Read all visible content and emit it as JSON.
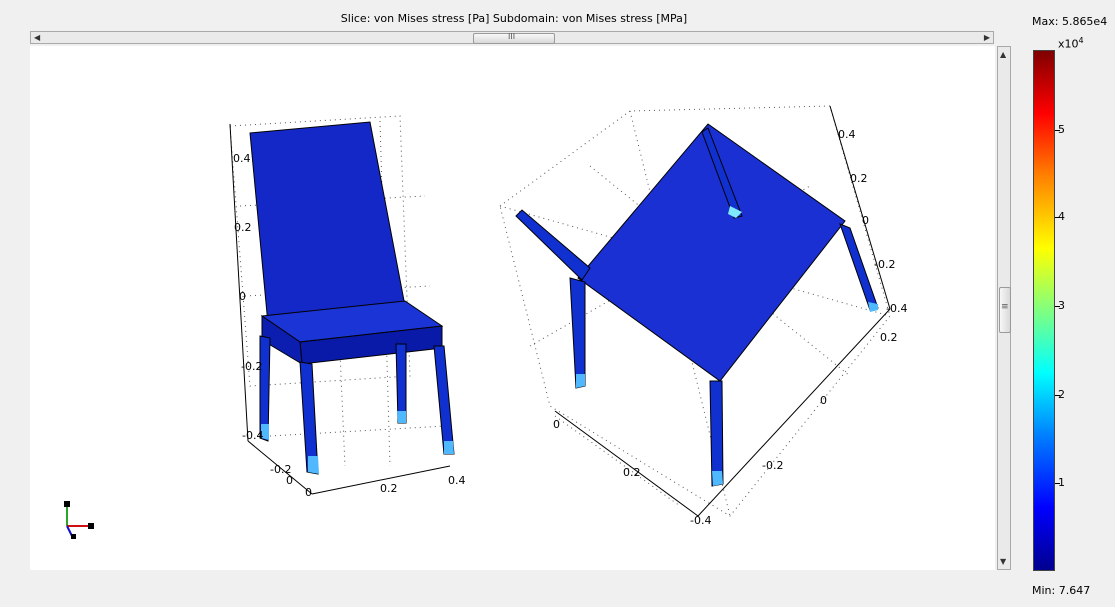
{
  "title": "Slice: von Mises stress [Pa]   Subdomain: von Mises stress [MPa]",
  "hscroll_thumb_grip": "III",
  "vscroll_thumb_grip": "≡",
  "colorbar": {
    "max_label": "Max: 5.865e4",
    "min_label": "Min: 7.647",
    "exponent_base": "x10",
    "exponent_power": "4",
    "ticks": [
      "5",
      "4",
      "3",
      "2",
      "1"
    ],
    "colormap": "jet"
  },
  "left_view": {
    "z_ticks": [
      "0.4",
      "0.2",
      "0",
      "-0.2",
      "-0.4"
    ],
    "y_ticks": [
      "-0.2",
      "0"
    ],
    "x_ticks": [
      "0",
      "0.2",
      "0.4"
    ]
  },
  "right_view": {
    "z_ticks": [
      "0.4",
      "0.2",
      "0",
      "-0.2",
      "-0.4"
    ],
    "y_ticks": [
      "0.2",
      "0",
      "-0.2",
      "-0.4"
    ],
    "x_ticks": [
      "0",
      "0.2"
    ]
  }
}
